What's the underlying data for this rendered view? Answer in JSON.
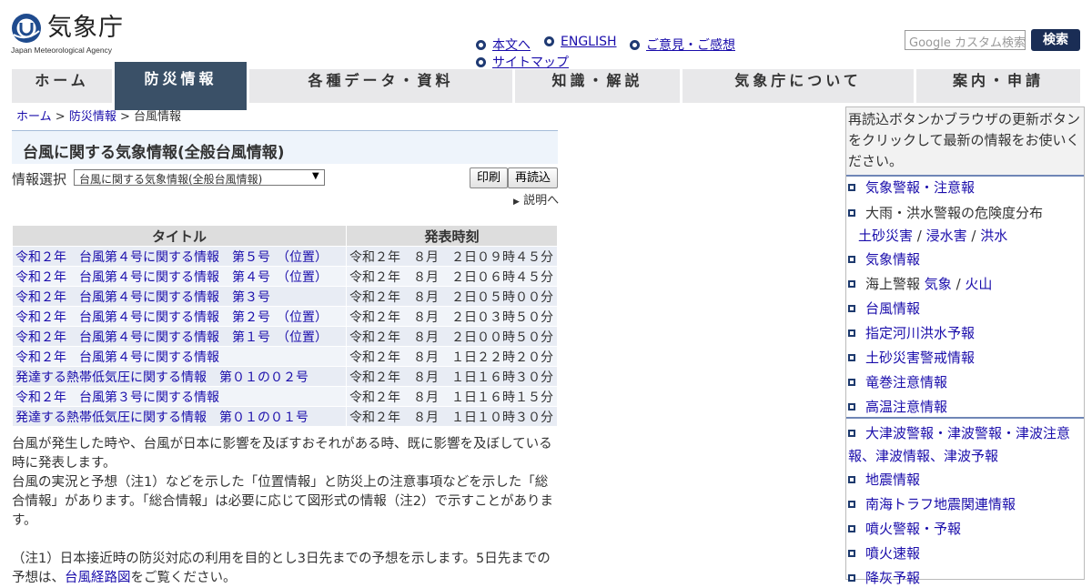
{
  "header": {
    "logo_text": "気象庁",
    "logo_sub": "Japan Meteorological Agency",
    "links": [
      "本文へ",
      "ENGLISH",
      "ご意見・ご感想",
      "サイトマップ"
    ],
    "search_placeholder": "Google カスタム検索",
    "search_button": "検索"
  },
  "nav": {
    "items": [
      "ホーム",
      "防災情報",
      "各種データ・資料",
      "知識・解説",
      "気象庁について",
      "案内・申請"
    ],
    "active": "防災情報"
  },
  "breadcrumb": {
    "home": "ホーム",
    "section": "防災情報",
    "current": "台風情報",
    "separator": ">"
  },
  "main": {
    "title": "台風に関する気象情報(全般台風情報)",
    "select_label": "情報選択",
    "select_value": "台風に関する気象情報(全般台風情報)",
    "print_button": "印刷",
    "reload_button": "再読込",
    "help_link": "説明へ",
    "table": {
      "headers": [
        "タイトル",
        "発表時刻"
      ],
      "rows": [
        {
          "title": "令和２年　台風第４号に関する情報　第５号　（位置）",
          "time": "令和２年　８月　２日０９時４５分"
        },
        {
          "title": "令和２年　台風第４号に関する情報　第４号　（位置）",
          "time": "令和２年　８月　２日０６時４５分"
        },
        {
          "title": "令和２年　台風第４号に関する情報　第３号",
          "time": "令和２年　８月　２日０５時００分"
        },
        {
          "title": "令和２年　台風第４号に関する情報　第２号　（位置）",
          "time": "令和２年　８月　２日０３時５０分"
        },
        {
          "title": "令和２年　台風第４号に関する情報　第１号　（位置）",
          "time": "令和２年　８月　２日００時５０分"
        },
        {
          "title": "令和２年　台風第４号に関する情報",
          "time": "令和２年　８月　１日２２時２０分"
        },
        {
          "title": "発達する熱帯低気圧に関する情報　第０１の０２号",
          "time": "令和２年　８月　１日１６時３０分"
        },
        {
          "title": "令和２年　台風第３号に関する情報",
          "time": "令和２年　８月　１日１６時１５分"
        },
        {
          "title": "発達する熱帯低気圧に関する情報　第０１の０１号",
          "time": "令和２年　８月　１日１０時３０分"
        }
      ]
    },
    "description": {
      "p1": "台風が発生した時や、台風が日本に影響を及ぼすおそれがある時、既に影響を及ぼしている時に発表します。",
      "p2": "台風の実況と予想（注1）などを示した「位置情報」と防災上の注意事項などを示した「総合情報」があります。「総合情報」は必要に応じて図形式の情報（注2）で示すことがあります。",
      "note1_prefix": "（注1）日本接近時の防災対応の利用を目的とし3日先までの予想を示します。5日先までの予想は、",
      "note1_link": "台風経路図",
      "note1_suffix": "をご覧ください。"
    }
  },
  "sidebar": {
    "note": "再読込ボタンかブラウザの更新ボタンをクリックして最新の情報をお使いください。",
    "items": {
      "warnings": "気象警報・注意報",
      "risk_label": "大雨・洪水警報の危険度分布",
      "risk_landslide": "土砂災害",
      "risk_inundation": "浸水害",
      "risk_flood": "洪水",
      "weather_info": "気象情報",
      "marine_label": "海上警報",
      "marine_weather": "気象",
      "marine_volcano": "火山",
      "typhoon": "台風情報",
      "river_flood": "指定河川洪水予報",
      "landslide_alert": "土砂災害警戒情報",
      "tornado": "竜巻注意情報",
      "heat": "高温注意情報",
      "tsunami": "大津波警報・津波警報・津波注意報、津波情報、津波予報",
      "earthquake": "地震情報",
      "nankai": "南海トラフ地震関連情報",
      "eruption_warning": "噴火警報・予報",
      "eruption_flash": "噴火速報",
      "ashfall": "降灰予報"
    }
  },
  "colors": {
    "nav_active": "#3a5067",
    "nav_bg": "#e8e8ea",
    "search_button": "#1a2d55",
    "link": "#1a0dab",
    "title_bg": "#eef4fb"
  }
}
